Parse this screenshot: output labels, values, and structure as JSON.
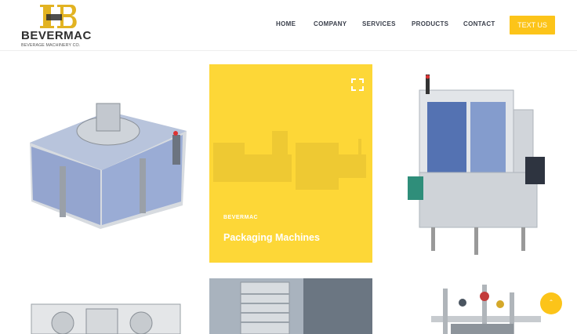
{
  "header": {
    "logo_brand": "BEVERMAC",
    "logo_tagline": "BEVERAGE MACHINERY CO.",
    "nav": [
      "HOME",
      "COMPANY",
      "SERVICES",
      "PRODUCTS",
      "CONTACT"
    ],
    "cta_label": "TEXT US"
  },
  "highlight_card": {
    "brand": "BEVERMAC",
    "title": "Packaging Machines"
  },
  "icons": {
    "expand": "expand-icon",
    "scroll_top": "chevron-up-icon"
  },
  "colors": {
    "accent": "#fcc419",
    "card_highlight": "#fdd737",
    "text_dark": "#3a3f4b"
  }
}
